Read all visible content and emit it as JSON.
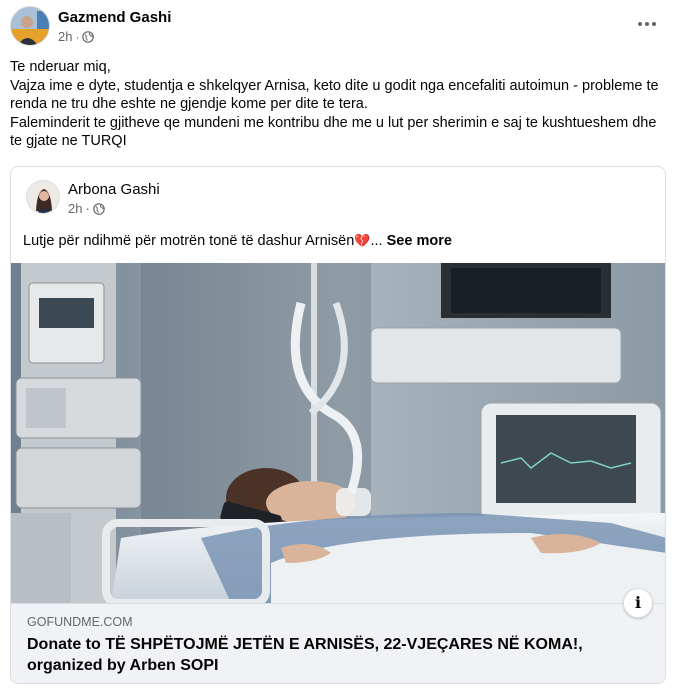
{
  "post": {
    "author": "Gazmend Gashi",
    "time": "2h",
    "separator": "·",
    "more_icon": "more-horizontal-icon",
    "text_lines": [
      "Te nderuar miq,",
      "Vajza ime e dyte, studentja e shkelqyer Arnisa, keto dite u godit nga encefaliti autoimun - probleme te renda ne tru dhe eshte ne gjendje kome per dite te tera.",
      "Faleminderit te gjitheve qe mundeni me kontribu dhe me u lut per sherimin e saj te kushtueshem dhe te gjate ne TURQI"
    ]
  },
  "shared": {
    "author": "Arbona Gashi",
    "time": "2h",
    "separator": "·",
    "text": "Lutje për ndihmë për motrën tonë të dashur Arnisën",
    "heart_emoji": "💔",
    "ellipsis": "...",
    "see_more": "See more"
  },
  "link": {
    "domain": "GOFUNDME.COM",
    "title": "Donate to TË SHPËTOJMË JETËN E ARNISËS, 22-VJEÇARES NË KOMA!, organized by Arben SOPI",
    "info_icon": "i"
  },
  "colors": {
    "secondary_text": "#65676b",
    "link_bar_bg": "#f0f2f5",
    "border": "#dadde1"
  }
}
